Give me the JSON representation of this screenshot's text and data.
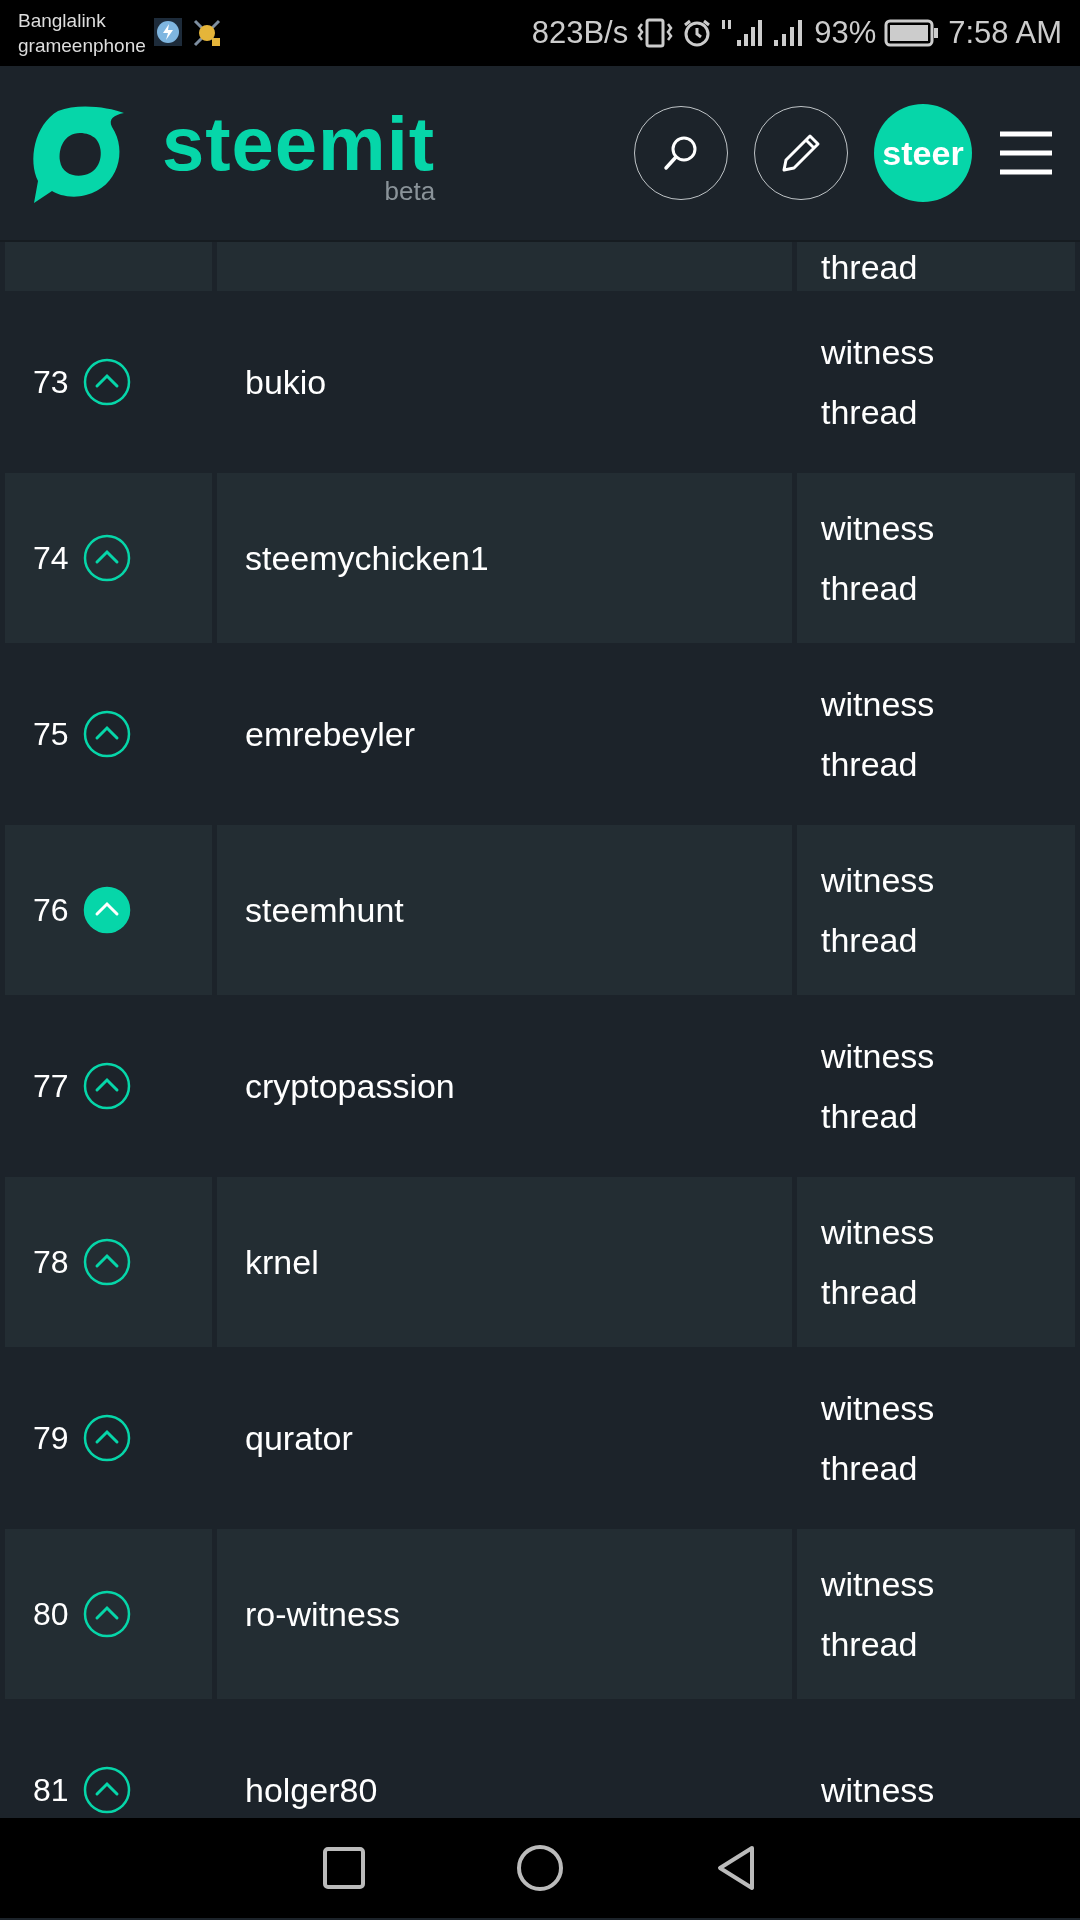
{
  "status_bar": {
    "carriers": [
      "Banglalink",
      "grameenphone"
    ],
    "speed": "823B/s",
    "battery": "93%",
    "time": "7:58 AM"
  },
  "header": {
    "logo": "steemit",
    "tag": "beta",
    "avatar": "steer"
  },
  "rows": [
    {
      "link": [
        "thread"
      ]
    },
    {
      "rank": "73",
      "voted": false,
      "name": "bukio",
      "link": [
        "witness",
        "thread"
      ]
    },
    {
      "rank": "74",
      "voted": false,
      "name": "steemychicken1",
      "link": [
        "witness",
        "thread"
      ]
    },
    {
      "rank": "75",
      "voted": false,
      "name": "emrebeyler",
      "link": [
        "witness",
        "thread"
      ]
    },
    {
      "rank": "76",
      "voted": true,
      "name": "steemhunt",
      "link": [
        "witness",
        "thread"
      ]
    },
    {
      "rank": "77",
      "voted": false,
      "name": "cryptopassion",
      "link": [
        "witness",
        "thread"
      ]
    },
    {
      "rank": "78",
      "voted": false,
      "name": "krnel",
      "link": [
        "witness",
        "thread"
      ]
    },
    {
      "rank": "79",
      "voted": false,
      "name": "qurator",
      "link": [
        "witness",
        "thread"
      ]
    },
    {
      "rank": "80",
      "voted": false,
      "name": "ro-witness",
      "link": [
        "witness",
        "thread"
      ]
    },
    {
      "rank": "81",
      "voted": false,
      "name": "holger80",
      "link": [
        "witness"
      ]
    }
  ]
}
